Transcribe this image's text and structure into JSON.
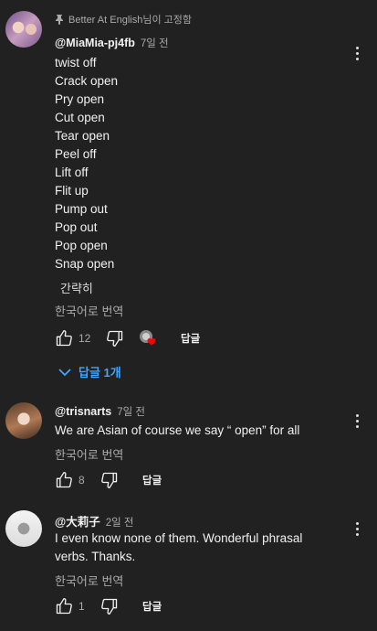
{
  "comments": [
    {
      "pinned_label": "Better At English님이 고정함",
      "author": "@MiaMia-pj4fb",
      "time": "7일 전",
      "lines": [
        "twist off",
        "Crack open",
        "Pry open",
        "Cut open",
        "Tear open",
        "Peel off",
        "Lift off",
        "Flit up",
        "Pump out",
        "Pop out",
        "Pop open",
        "Snap open"
      ],
      "collapse_label": "간략히",
      "translate_label": "한국어로 번역",
      "likes": "12",
      "reply_label": "답글",
      "replies_toggle": "답글 1개",
      "icons": [
        "pin-icon",
        "thumb-up-icon",
        "thumb-down-icon",
        "creator-heart-icon",
        "more-vert-icon",
        "chevron-down-icon"
      ]
    },
    {
      "author": "@trisnarts",
      "time": "7일 전",
      "lines": [
        "We are Asian of course we say “ open” for all"
      ],
      "translate_label": "한국어로 번역",
      "likes": "8",
      "reply_label": "답글"
    },
    {
      "author": "@大莉子",
      "time": "2일 전",
      "lines": [
        "I even know none of them. Wonderful phrasal",
        "verbs. Thanks."
      ],
      "translate_label": "한국어로 번역",
      "likes": "1",
      "reply_label": "답글"
    }
  ],
  "colors": {
    "background": "#212121",
    "link_blue": "#3ea6ff",
    "heart_red": "#ff0000",
    "secondary_text": "#aaaaaa"
  }
}
